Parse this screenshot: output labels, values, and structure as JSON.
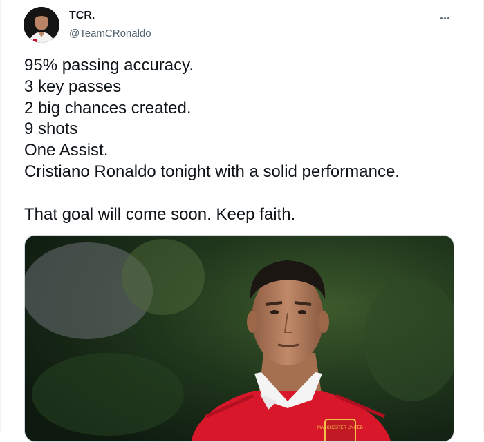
{
  "tweet": {
    "display_name": "TCR.",
    "handle": "@TeamCRonaldo",
    "more_icon": "more-horizontal-icon",
    "lines": [
      "95% passing accuracy.",
      "3 key passes",
      "2 big chances created.",
      "9 shots",
      "One Assist.",
      "Cristiano Ronaldo tonight with a solid performance.",
      "",
      "That goal will come soon. Keep faith."
    ],
    "media": {
      "description_icon": "player-photo",
      "badge_text": "MANCHESTER UNITED"
    }
  },
  "colors": {
    "text_primary": "#0f1419",
    "text_secondary": "#536471",
    "jersey_red": "#d8182a",
    "background_green": "#1f3a22"
  }
}
